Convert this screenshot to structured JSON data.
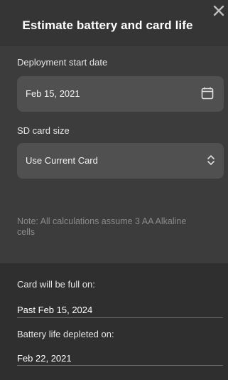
{
  "dialog": {
    "title": "Estimate battery and card life",
    "close_icon": "close-icon"
  },
  "start_date": {
    "label": "Deployment start date",
    "value": "Feb 15, 2021",
    "icon": "calendar-icon"
  },
  "sd_card": {
    "label": "SD card size",
    "selected": "Use Current Card",
    "icon": "chevron-up-down-icon"
  },
  "note": "Note: All calculations assume 3 AA Alkaline cells",
  "results": {
    "card_full_label": "Card will be full on:",
    "card_full_value": "Past Feb 15, 2024",
    "battery_label": "Battery life depleted on:",
    "battery_value": "Feb 22, 2021"
  },
  "colors": {
    "background": "#3c3c3c",
    "field": "#505050",
    "results_background": "#2f2f2f",
    "muted_text": "#8a8a8a"
  }
}
